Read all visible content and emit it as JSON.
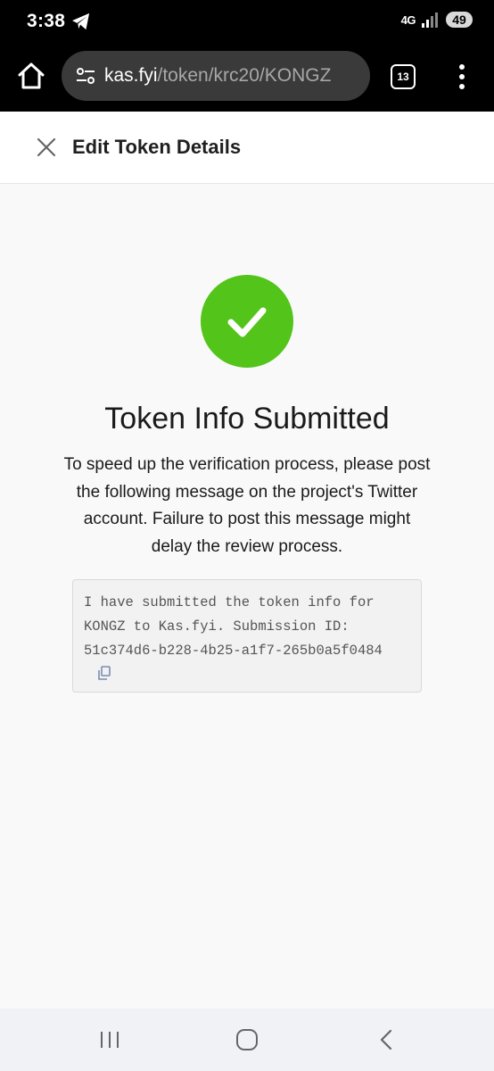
{
  "status_bar": {
    "time": "3:38",
    "network": "4G",
    "battery": "49",
    "icons": [
      "telegram-icon",
      "signal-icon"
    ]
  },
  "browser": {
    "url_host": "kas.fyi",
    "url_path": "/token/krc20/KONGZ",
    "tab_count": "13",
    "icons": [
      "home-icon",
      "page-info-icon",
      "tabs-icon",
      "overflow-menu-icon"
    ]
  },
  "header": {
    "title": "Edit Token Details",
    "close_icon": "close-icon"
  },
  "success": {
    "icon": "checkmark-icon",
    "color": "#52c41a",
    "title": "Token Info Submitted",
    "description": "To speed up the verification process, please post the following message on the project's Twitter account. Failure to post this message might delay the review process.",
    "message": "I have submitted the token info for KONGZ to Kas.fyi. Submission ID: 51c374d6-b228-4b25-a1f7-265b0a5f0484",
    "copy_icon": "copy-icon"
  },
  "nav_bar": {
    "icons": [
      "recent-apps-icon",
      "home-nav-icon",
      "back-icon"
    ]
  }
}
